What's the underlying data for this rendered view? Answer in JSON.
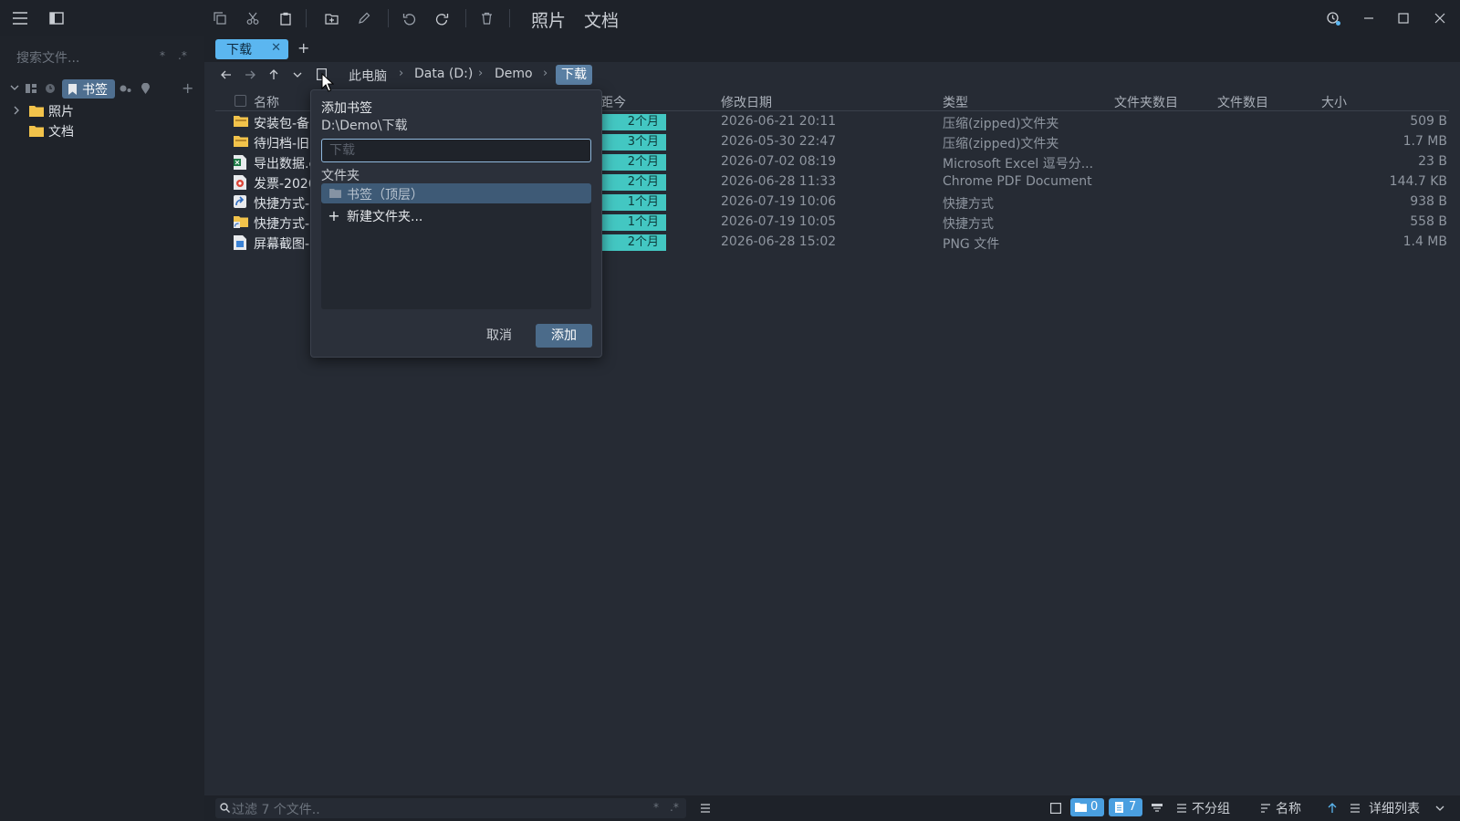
{
  "search": {
    "placeholder": "搜索文件..."
  },
  "quick_access": [
    "照片",
    "文档"
  ],
  "sidebar": {
    "bookmark_chip": "书签",
    "tree": [
      {
        "label": "照片"
      },
      {
        "label": "文档"
      }
    ]
  },
  "tabs": [
    {
      "label": "下载"
    }
  ],
  "breadcrumb": [
    "此电脑",
    "Data (D:)",
    "Demo",
    "下载"
  ],
  "columns": {
    "name": "名称",
    "age": "距今",
    "modified": "修改日期",
    "type": "类型",
    "folder_count": "文件夹数目",
    "file_count": "文件数目",
    "size": "大小"
  },
  "files": [
    {
      "name": "安装包-备",
      "icon": "zip-folder-icon",
      "age": "2个月",
      "modified": "2026-06-21 20:11",
      "type": "压缩(zipped)文件夹",
      "size": "509 B"
    },
    {
      "name": "待归档-旧",
      "icon": "zip-folder-icon",
      "age": "3个月",
      "modified": "2026-05-30 22:47",
      "type": "压缩(zipped)文件夹",
      "size": "1.7 MB"
    },
    {
      "name": "导出数据.c",
      "icon": "excel-icon",
      "age": "2个月",
      "modified": "2026-07-02 08:19",
      "type": "Microsoft Excel 逗号分...",
      "size": "23 B"
    },
    {
      "name": "发票-2026",
      "icon": "pdf-icon",
      "age": "2个月",
      "modified": "2026-06-28 11:33",
      "type": "Chrome PDF Document",
      "size": "144.7 KB"
    },
    {
      "name": "快捷方式-",
      "icon": "shortcut-icon",
      "age": "1个月",
      "modified": "2026-07-19 10:06",
      "type": "快捷方式",
      "size": "938 B"
    },
    {
      "name": "快捷方式-",
      "icon": "folder-shortcut-icon",
      "age": "1个月",
      "modified": "2026-07-19 10:05",
      "type": "快捷方式",
      "size": "558 B"
    },
    {
      "name": "屏幕截图-",
      "icon": "png-icon",
      "age": "2个月",
      "modified": "2026-06-28 15:02",
      "type": "PNG 文件",
      "size": "1.4 MB"
    }
  ],
  "bookmark_dialog": {
    "title": "添加书签",
    "path": "D:\\Demo\\下载",
    "name_placeholder": "下载",
    "folder_label": "文件夹",
    "folders": [
      "书签（顶层）"
    ],
    "new_folder": "新建文件夹...",
    "cancel": "取消",
    "add": "添加"
  },
  "statusbar": {
    "filter_placeholder": "过滤 7 个文件..",
    "folder_count": "0",
    "file_count": "7",
    "group": "不分组",
    "sort": "名称",
    "view": "详细列表"
  },
  "colors": {
    "accent": "#5bb6f0",
    "age_badge": "#43c7c2",
    "dialog_primary": "#4b6b8a"
  }
}
